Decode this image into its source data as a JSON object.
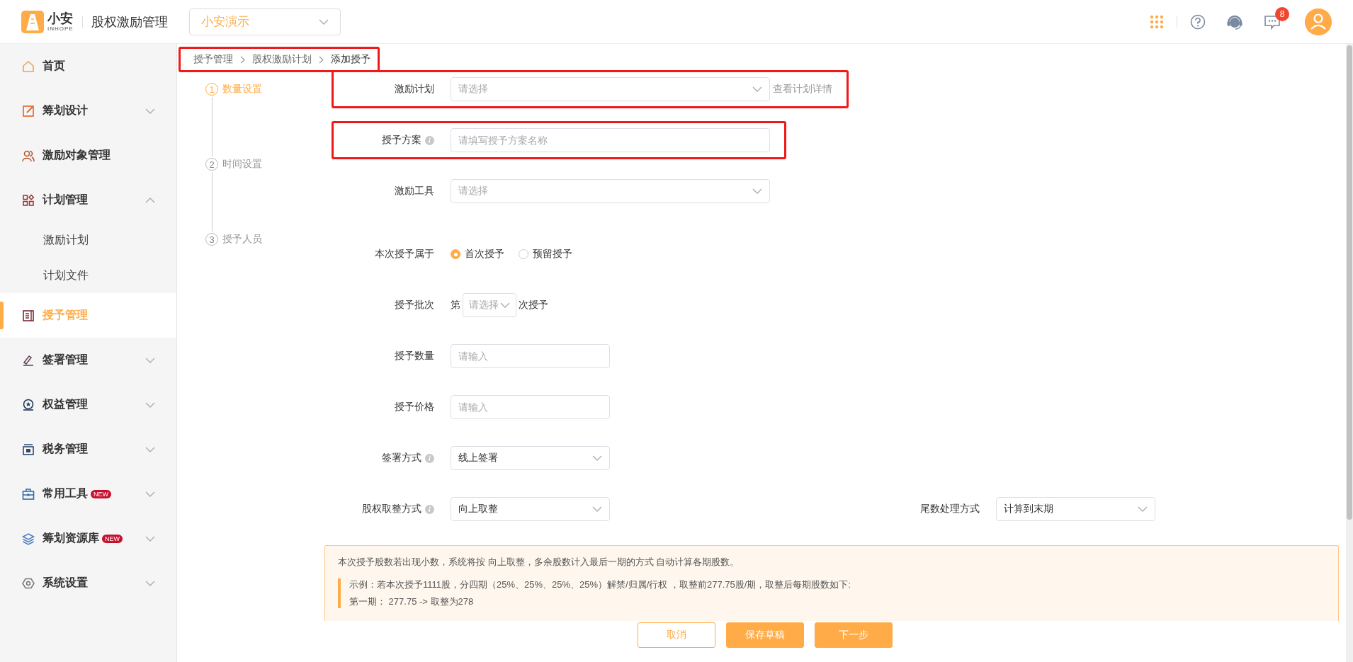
{
  "header": {
    "logo_text": "小安",
    "logo_subtext": "INHOPE",
    "title": "股权激励管理",
    "company_select": "小安演示",
    "message_count": "8"
  },
  "sidebar": {
    "items": [
      {
        "label": "首页",
        "selected": false
      },
      {
        "label": "筹划设计",
        "selected": false,
        "expanded": false
      },
      {
        "label": "激励对象管理",
        "selected": false
      },
      {
        "label": "计划管理",
        "selected": false,
        "expanded": true,
        "children": [
          {
            "label": "激励计划",
            "selected": false
          },
          {
            "label": "计划文件",
            "selected": false
          }
        ]
      },
      {
        "label": "授予管理",
        "selected": true
      },
      {
        "label": "签署管理",
        "selected": false,
        "expanded": false
      },
      {
        "label": "权益管理",
        "selected": false,
        "expanded": false
      },
      {
        "label": "税务管理",
        "selected": false,
        "expanded": false
      },
      {
        "label": "常用工具",
        "selected": false,
        "expanded": false,
        "badge": "NEW"
      },
      {
        "label": "筹划资源库",
        "selected": false,
        "expanded": false,
        "badge": "NEW"
      },
      {
        "label": "系统设置",
        "selected": false,
        "expanded": false
      }
    ]
  },
  "breadcrumb": {
    "highlighted": true,
    "items": [
      "授予管理",
      "股权激励计划",
      "添加授予"
    ]
  },
  "steps": [
    {
      "number": "1",
      "label": "数量设置",
      "selected": true
    },
    {
      "number": "2",
      "label": "时间设置",
      "selected": false
    },
    {
      "number": "3",
      "label": "授予人员",
      "selected": false
    }
  ],
  "form": {
    "rows": [
      {
        "kind": "wide-select",
        "label": "激励计划",
        "info": false,
        "highlighted": true,
        "placeholder": "请选择",
        "link": "查看计划详情"
      },
      {
        "kind": "wide-input",
        "label": "授予方案",
        "info": true,
        "highlighted": true,
        "placeholder": "请填写授予方案名称"
      },
      {
        "kind": "wide-select",
        "label": "激励工具",
        "info": false,
        "highlighted": false,
        "placeholder": "请选择"
      },
      {
        "kind": "radio",
        "label": "本次授予属于",
        "info": false,
        "highlighted": false,
        "options": [
          {
            "label": "首次授予",
            "selected": true
          },
          {
            "label": "预留授予",
            "selected": false
          }
        ]
      },
      {
        "kind": "batch",
        "label": "授予批次",
        "info": false,
        "highlighted": false,
        "prefix": "第",
        "placeholder": "请选择",
        "suffix": "次授予"
      },
      {
        "kind": "input",
        "label": "授予数量",
        "info": false,
        "highlighted": false,
        "placeholder": "请输入"
      },
      {
        "kind": "input",
        "label": "授予价格",
        "info": false,
        "highlighted": false,
        "placeholder": "请输入"
      },
      {
        "kind": "select",
        "label": "签署方式",
        "info": true,
        "highlighted": false,
        "value": "线上签署"
      },
      {
        "kind": "select",
        "label": "股权取整方式",
        "info": true,
        "highlighted": false,
        "value": "向上取整",
        "side": {
          "label": "尾数处理方式",
          "value": "计算到末期"
        }
      }
    ]
  },
  "notice": {
    "text": "本次授予股数若出现小数，系统将按 向上取整，多余股数计入最后一期的方式 自动计算各期股数。",
    "example_lines": [
      "示例：若本次授予1111股，分四期（25%、25%、25%、25%）解禁/归属/行权 ，取整前277.75股/期，取整后每期股数如下:",
      "第一期： 277.75 -> 取整为278"
    ]
  },
  "buttons": [
    {
      "label": "取消",
      "kind": "outline"
    },
    {
      "label": "保存草稿",
      "kind": "primary"
    },
    {
      "label": "下一步",
      "kind": "primary"
    }
  ]
}
